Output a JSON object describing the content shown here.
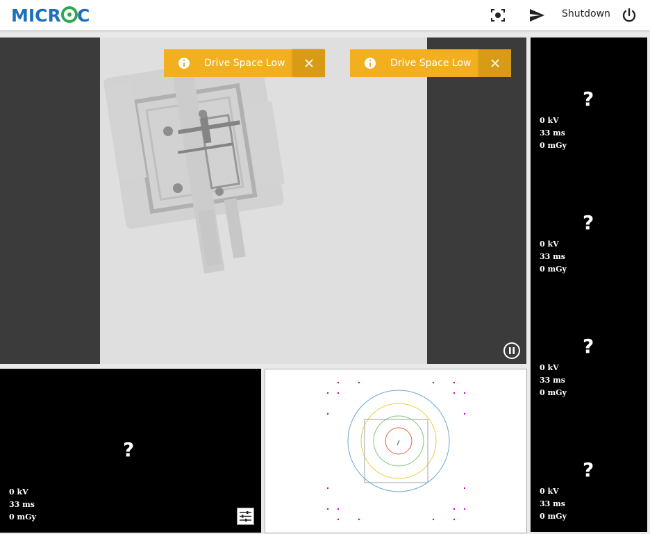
{
  "header": {
    "logo_text": "MICROC",
    "shutdown_label": "Shutdown",
    "icons": [
      "camera-focus-icon",
      "send-icon",
      "power-icon"
    ]
  },
  "main_view": {
    "toasts": [
      {
        "message": "Drive Space Low",
        "icon": "info-icon"
      },
      {
        "message": "Drive Space Low",
        "icon": "info-icon"
      }
    ],
    "pause_icon": "pause-icon"
  },
  "thumbnails": [
    {
      "placeholder": "?",
      "kv": "0 kV",
      "ms": "33 ms",
      "dose": "0 mGy"
    },
    {
      "placeholder": "?",
      "kv": "0 kV",
      "ms": "33 ms",
      "dose": "0 mGy"
    },
    {
      "placeholder": "?",
      "kv": "0 kV",
      "ms": "33 ms",
      "dose": "0 mGy"
    },
    {
      "placeholder": "?",
      "kv": "0 kV",
      "ms": "33 ms",
      "dose": "0 mGy"
    }
  ],
  "bottom_left": {
    "placeholder": "?",
    "kv": "0 kV",
    "ms": "33 ms",
    "dose": "0 mGy",
    "icon": "sliders-icon"
  },
  "colors": {
    "toast": "#f2b01e",
    "logo_blue": "#1e6fb8",
    "logo_green": "#2fa84f",
    "marker": "#c000c0"
  }
}
